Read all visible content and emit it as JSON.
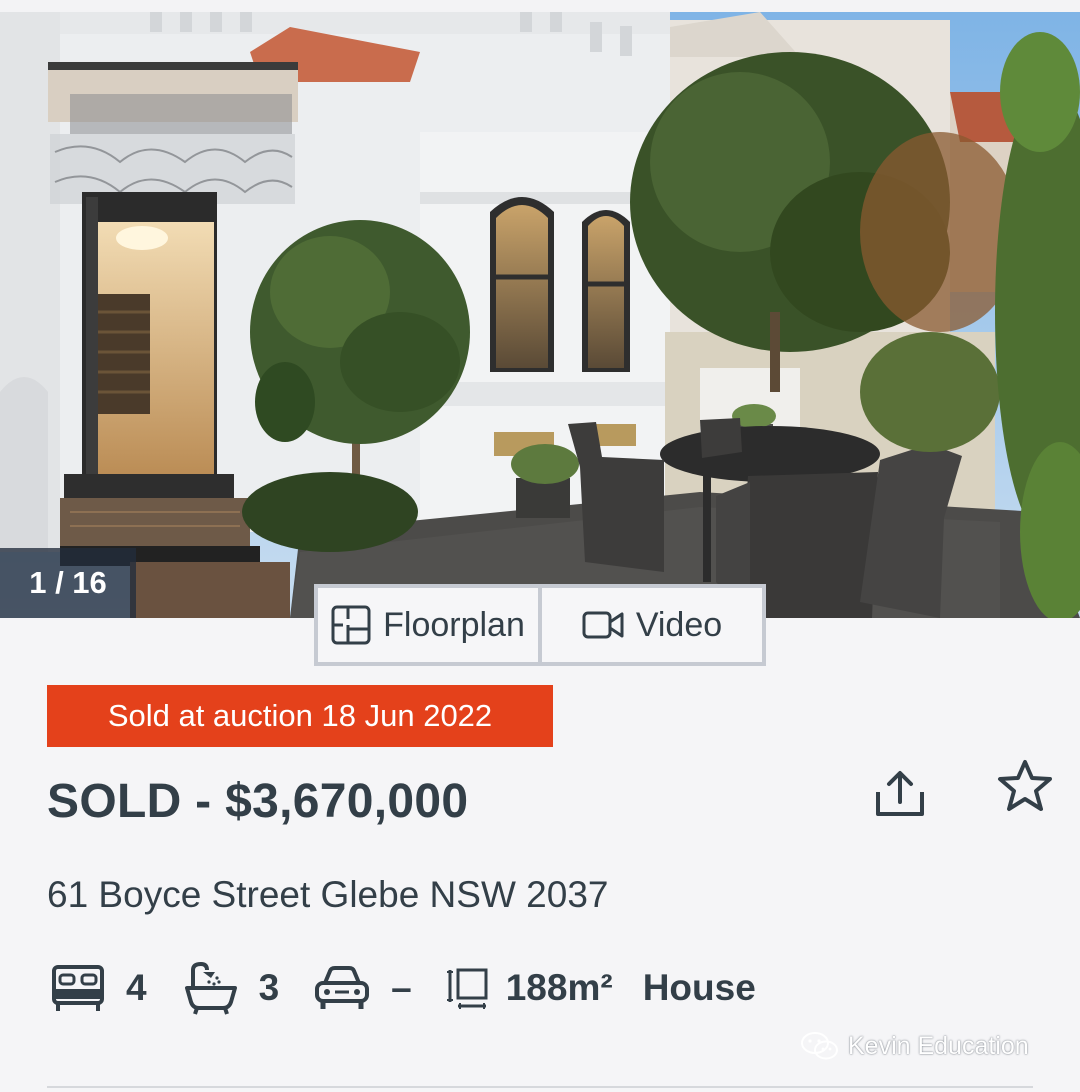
{
  "gallery": {
    "counter": "1 / 16"
  },
  "media": {
    "floorplan_label": "Floorplan",
    "video_label": "Video"
  },
  "listing": {
    "status_banner": "Sold at auction 18 Jun 2022",
    "price": "SOLD - $3,670,000",
    "address": "61 Boyce Street Glebe NSW 2037"
  },
  "features": {
    "beds": "4",
    "baths": "3",
    "cars": "–",
    "land_size": "188m²",
    "property_type": "House"
  },
  "icons": {
    "share": "share-icon",
    "favourite": "star-icon",
    "floorplan": "floorplan-icon",
    "video": "video-camera-icon",
    "beds": "bed-icon",
    "baths": "bath-icon",
    "cars": "car-icon",
    "land": "land-size-icon",
    "watermark": "wechat-icon"
  },
  "watermark": {
    "text": "Kevin Education"
  },
  "colors": {
    "sold_banner": "#e4411b",
    "text": "#333f48",
    "background": "#f5f5f7"
  }
}
